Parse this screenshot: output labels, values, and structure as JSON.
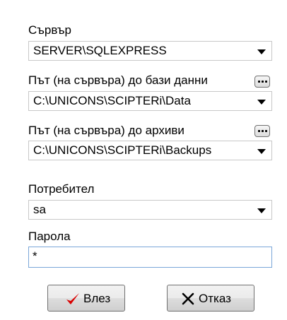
{
  "server": {
    "label": "Сървър",
    "value": "SERVER\\SQLEXPRESS"
  },
  "db_path": {
    "label": "Път (на сървъра) до бази данни",
    "value": "C:\\UNICONS\\SCIPTERi\\Data"
  },
  "archive_path": {
    "label": "Път (на сървъра) до архиви",
    "value": "C:\\UNICONS\\SCIPTERi\\Backups"
  },
  "user": {
    "label": "Потребител",
    "value": "sa"
  },
  "password": {
    "label": "Парола",
    "value": "*"
  },
  "buttons": {
    "login": "Влез",
    "cancel": "Отказ"
  },
  "colors": {
    "check": "#d90000",
    "focus_border": "#7aa7d8"
  },
  "icons": {
    "login": "checkmark-icon",
    "cancel": "x-icon",
    "browse": "ellipsis-icon",
    "dropdown": "dropdown-arrow-icon"
  }
}
